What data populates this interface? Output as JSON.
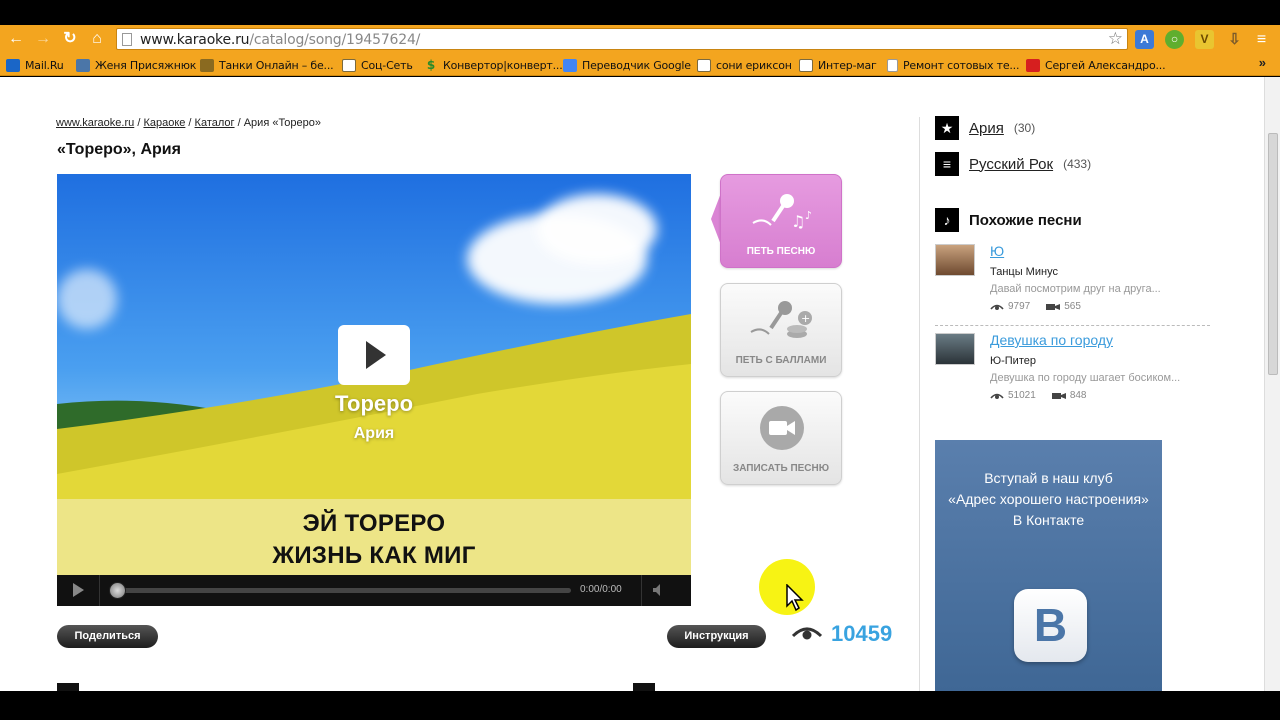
{
  "browser": {
    "url_host": "www.karaoke.ru",
    "url_path": "/catalog/song/19457624/",
    "bookmarks": [
      {
        "label": "Mail.Ru",
        "icon": "mailru-icon",
        "color": "#1a66c7"
      },
      {
        "label": "Женя Присяжнюк",
        "icon": "vk-icon",
        "color": "#4b76a8"
      },
      {
        "label": "Танки Онлайн – бе...",
        "icon": "tank-icon",
        "color": "#8a6a20"
      },
      {
        "label": "Соц-Сеть",
        "icon": "folder-icon"
      },
      {
        "label": "Конвертор|конверт...",
        "icon": "dollar-icon",
        "color": "#2a8a2a"
      },
      {
        "label": "Переводчик Google",
        "icon": "translate-icon",
        "color": "#4285f4"
      },
      {
        "label": "сони ериксон",
        "icon": "folder-icon"
      },
      {
        "label": "Интер-маг",
        "icon": "folder-icon"
      },
      {
        "label": "Ремонт сотовых те...",
        "icon": "page-icon"
      },
      {
        "label": "Сергей Александро...",
        "icon": "youtube-icon",
        "color": "#d61f1f"
      }
    ],
    "more": "»"
  },
  "breadcrumb": {
    "home": "www.karaoke.ru",
    "sep1": " / ",
    "karaoke": "Караоке",
    "sep2": " / ",
    "catalog": "Каталог",
    "sep3": " / ",
    "current": "Ария «Тореро»"
  },
  "page_title": "«Тореро», Ария",
  "video": {
    "song": "Тореро",
    "artist": "Ария",
    "lyric_line1": "ЭЙ ТОРЕРО",
    "lyric_line2": "ЖИЗНЬ КАК МИГ",
    "time": "0:00/0:00",
    "progress": 0.0
  },
  "actions": {
    "sing": "ПЕТЬ ПЕСНЮ",
    "sing_score": "ПЕТЬ С БАЛЛАМИ",
    "record": "ЗАПИСАТЬ ПЕСНЮ"
  },
  "share_label": "Поделиться",
  "instruction_label": "Инструкция",
  "views": "10459",
  "sidebar": {
    "categories": [
      {
        "name": "Ария",
        "count": "(30)",
        "icon": "star-icon"
      },
      {
        "name": "Русский Рок",
        "count": "(433)",
        "icon": "list-icon"
      }
    ],
    "similar_heading": "Похожие песни",
    "similar": [
      {
        "title": "Ю",
        "artist": "Танцы Минус",
        "lyric": "Давай посмотрим друг на друга...",
        "views": "9797",
        "videos": "565"
      },
      {
        "title": "Девушка по городу",
        "artist": "Ю-Питер",
        "lyric": "Девушка по городу шагает босиком...",
        "views": "51021",
        "videos": "848"
      }
    ]
  },
  "vk_banner": {
    "line1": "Вступай в наш клуб",
    "line2": "«Адрес хорошего настроения»",
    "line3": "В Контакте",
    "logo": "В"
  },
  "colors": {
    "chrome_theme": "#f3a51f",
    "views_blue": "#39a3e0",
    "pink_button": "#da84d4",
    "vk_blue": "#4b76a8"
  }
}
